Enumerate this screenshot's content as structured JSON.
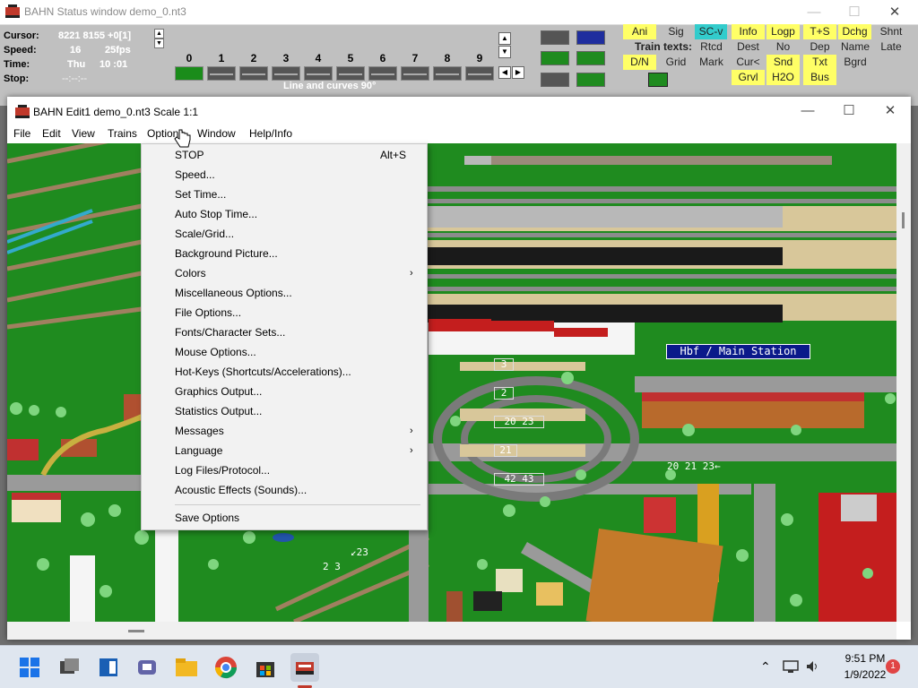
{
  "status_window": {
    "title": "BAHN Status window demo_0.nt3",
    "controls": {
      "minimize": "—",
      "maximize": "☐",
      "close": "✕"
    },
    "info": {
      "cursor_label": "Cursor:",
      "cursor_value": "8221   8155 +0[1]",
      "speed_label": "Speed:",
      "speed_value": "16",
      "fps_value": "25fps",
      "time_label": "Time:",
      "time_day": "Thu",
      "time_value": "10 :01",
      "stop_label": "Stop:",
      "stop_value": "--:--:--"
    },
    "digits": [
      "0",
      "1",
      "2",
      "3",
      "4",
      "5",
      "6",
      "7",
      "8",
      "9"
    ],
    "line_caption": "Line and curves 90°",
    "toggles_row1": [
      "Ani",
      "Sig",
      "SC-v",
      "Info",
      "Logp",
      "T+S",
      "Dchg",
      "Shnt"
    ],
    "train_texts_label": "Train texts:",
    "toggles_row2": [
      "Rtcd",
      "Dest",
      "No",
      "Dep",
      "Name",
      "Late"
    ],
    "toggles_row3": [
      "D/N",
      "Grid",
      "Mark",
      "Cur<",
      "Snd",
      "Txt",
      "Bgrd"
    ],
    "toggles_row4": [
      "Grvl",
      "H2O",
      "Bus"
    ]
  },
  "editor_window": {
    "title": "BAHN Edit1 demo_0.nt3 Scale 1:1",
    "controls": {
      "minimize": "—",
      "maximize": "☐",
      "close": "✕"
    },
    "menu": [
      "File",
      "Edit",
      "View",
      "Trains",
      "Options",
      "Window",
      "Help/Info"
    ],
    "station_label": "Hbf / Main Station",
    "platform_numbers": [
      "3",
      "2",
      "20 23",
      "21",
      "42 43"
    ],
    "map_texts": [
      "20 21 23←",
      "2 3",
      "↙23"
    ]
  },
  "options_menu": {
    "items": [
      {
        "label": "STOP",
        "shortcut": "Alt+S",
        "submenu": false
      },
      {
        "label": "Speed...",
        "shortcut": "",
        "submenu": false
      },
      {
        "label": "Set Time...",
        "shortcut": "",
        "submenu": false
      },
      {
        "label": "Auto Stop Time...",
        "shortcut": "",
        "submenu": false
      },
      {
        "label": "Scale/Grid...",
        "shortcut": "",
        "submenu": false
      },
      {
        "label": "Background Picture...",
        "shortcut": "",
        "submenu": false
      },
      {
        "label": "Colors",
        "shortcut": "",
        "submenu": true
      },
      {
        "label": "Miscellaneous Options...",
        "shortcut": "",
        "submenu": false
      },
      {
        "label": "File Options...",
        "shortcut": "",
        "submenu": false
      },
      {
        "label": "Fonts/Character Sets...",
        "shortcut": "",
        "submenu": false
      },
      {
        "label": "Mouse Options...",
        "shortcut": "",
        "submenu": false
      },
      {
        "label": "Hot-Keys (Shortcuts/Accelerations)...",
        "shortcut": "",
        "submenu": false
      },
      {
        "label": "Graphics Output...",
        "shortcut": "",
        "submenu": false
      },
      {
        "label": "Statistics Output...",
        "shortcut": "",
        "submenu": false
      },
      {
        "label": "Messages",
        "shortcut": "",
        "submenu": true
      },
      {
        "label": "Language",
        "shortcut": "",
        "submenu": true
      },
      {
        "label": "Log Files/Protocol...",
        "shortcut": "",
        "submenu": false
      },
      {
        "label": "Acoustic Effects (Sounds)...",
        "shortcut": "",
        "submenu": false
      }
    ],
    "save_label": "Save Options"
  },
  "taskbar": {
    "time": "9:51 PM",
    "date": "1/9/2022",
    "notification_count": "1",
    "apps": [
      "start-icon",
      "task-view-icon",
      "widgets-icon",
      "chat-icon",
      "file-explorer-icon",
      "chrome-icon",
      "store-icon",
      "bahn-icon"
    ]
  },
  "colors": {
    "canvas_green": "#1f8b1f",
    "toggle_yellow": "#ffff66",
    "toggle_cyan": "#33cccc",
    "station_blue": "#0a1a8a"
  }
}
